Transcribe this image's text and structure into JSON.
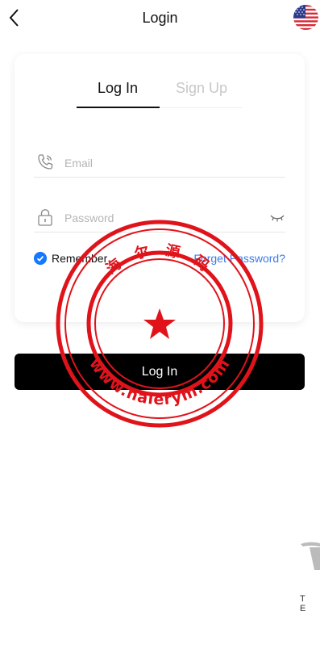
{
  "header": {
    "title": "Login",
    "back_icon": "chevron-left-icon",
    "language_flag": "us-flag-icon"
  },
  "tabs": [
    {
      "label": "Log In",
      "active": true
    },
    {
      "label": "Sign Up",
      "active": false
    }
  ],
  "form": {
    "email": {
      "placeholder": "Email",
      "value": "",
      "icon": "phone-icon"
    },
    "password": {
      "placeholder": "Password",
      "value": "",
      "icon": "lock-icon",
      "toggle_icon": "eye-closed-icon"
    },
    "remember": {
      "label": "Remember",
      "checked": true
    },
    "forgot_link": "Forget Password?"
  },
  "login_button": "Log In",
  "watermark": {
    "text_top": "海 尔 源 码",
    "text_bottom": "www.haierym.com"
  },
  "footer_logo_text": "T E",
  "colors": {
    "accent": "#1677ff",
    "link": "#3d7be8",
    "button_bg": "#000000",
    "stamp": "#e0131b"
  }
}
